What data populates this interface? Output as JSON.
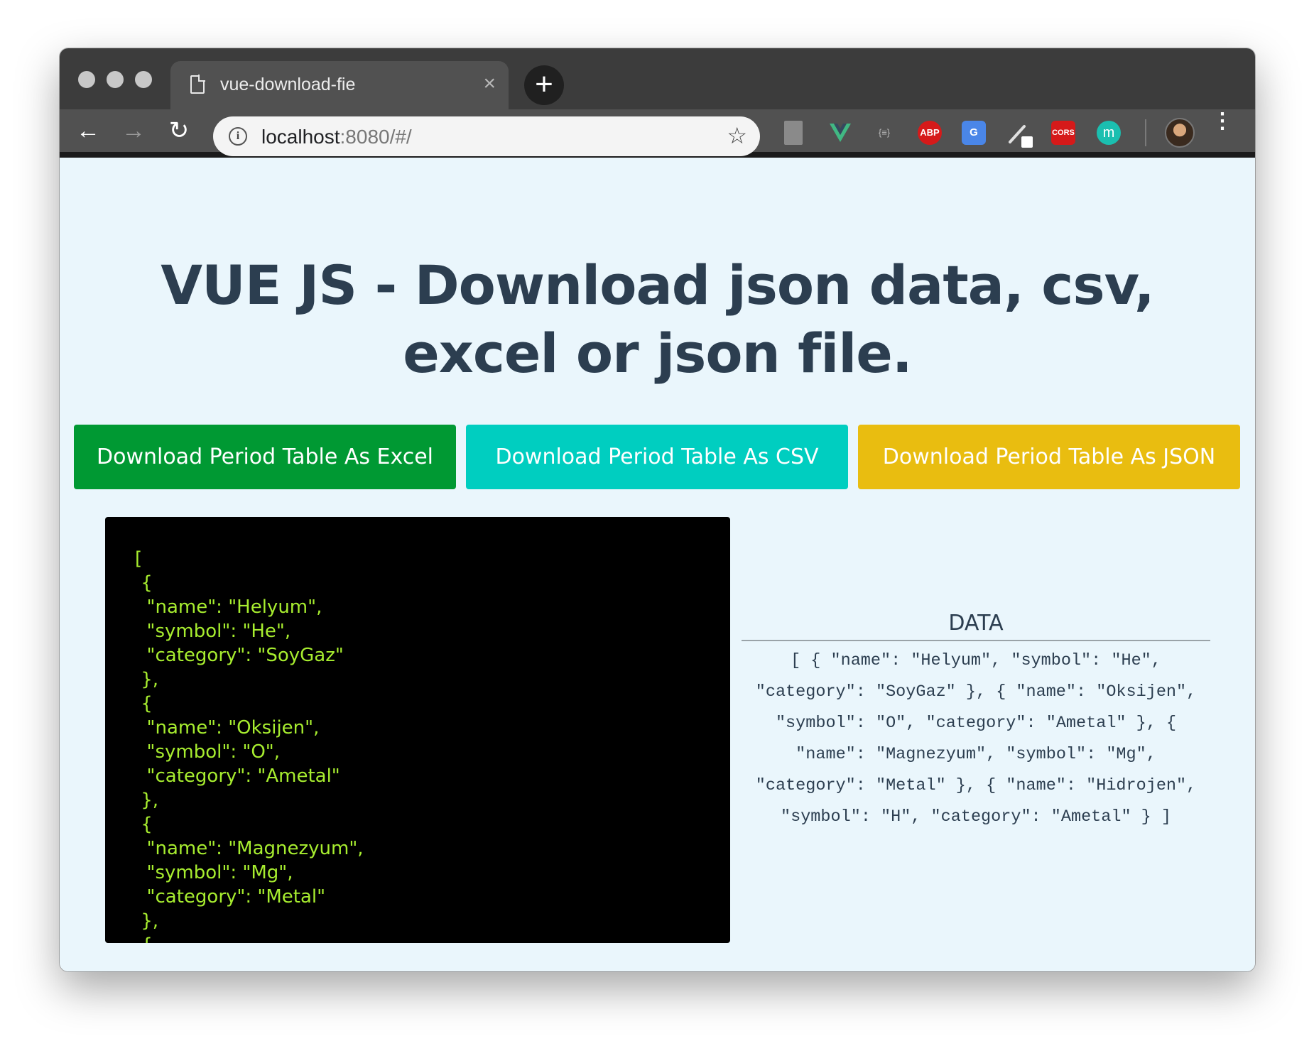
{
  "browser": {
    "tab_title": "vue-download-fie",
    "tab_close": "×",
    "new_tab": "+",
    "url_host": "localhost",
    "url_rest": ":8080/#/",
    "info_icon": "i",
    "back_icon": "←",
    "forward_icon": "→",
    "reload_icon": "↻",
    "star_icon": "☆",
    "menu_icon": "⋮",
    "extensions": [
      {
        "name": "file-extension-icon",
        "label": ""
      },
      {
        "name": "vue-devtools-icon",
        "label": ""
      },
      {
        "name": "json-formatter-icon",
        "label": "{≡}"
      },
      {
        "name": "adblock-plus-icon",
        "label": "ABP"
      },
      {
        "name": "google-translate-icon",
        "label": "G"
      },
      {
        "name": "color-picker-icon",
        "label": ""
      },
      {
        "name": "cors-icon",
        "label": "CORS"
      },
      {
        "name": "mercury-icon",
        "label": "m"
      }
    ]
  },
  "page": {
    "title": "VUE JS - Download json data, csv, excel or json file.",
    "buttons": {
      "excel": "Download Period Table As Excel",
      "csv": "Download Period Table As CSV",
      "json": "Download Period Table As JSON"
    },
    "code_lines": "[\n {\n  \"name\": \"Helyum\",\n  \"symbol\": \"He\",\n  \"category\": \"SoyGaz\"\n },\n {\n  \"name\": \"Oksijen\",\n  \"symbol\": \"O\",\n  \"category\": \"Ametal\"\n },\n {\n  \"name\": \"Magnezyum\",\n  \"symbol\": \"Mg\",\n  \"category\": \"Metal\"\n },\n {",
    "data_heading": "DATA",
    "data_text": "[ { \"name\": \"Helyum\", \"symbol\": \"He\", \"category\": \"SoyGaz\" }, { \"name\": \"Oksijen\", \"symbol\": \"O\", \"category\": \"Ametal\" }, { \"name\": \"Magnezyum\", \"symbol\": \"Mg\", \"category\": \"Metal\" }, { \"name\": \"Hidrojen\", \"symbol\": \"H\", \"category\": \"Ametal\" } ]"
  },
  "colors": {
    "excel_button": "#009933",
    "csv_button": "#00cec0",
    "json_button": "#e9bd10",
    "page_background": "#eaf6fc",
    "code_text": "#a7ed2f",
    "heading_text": "#2c3e50"
  }
}
